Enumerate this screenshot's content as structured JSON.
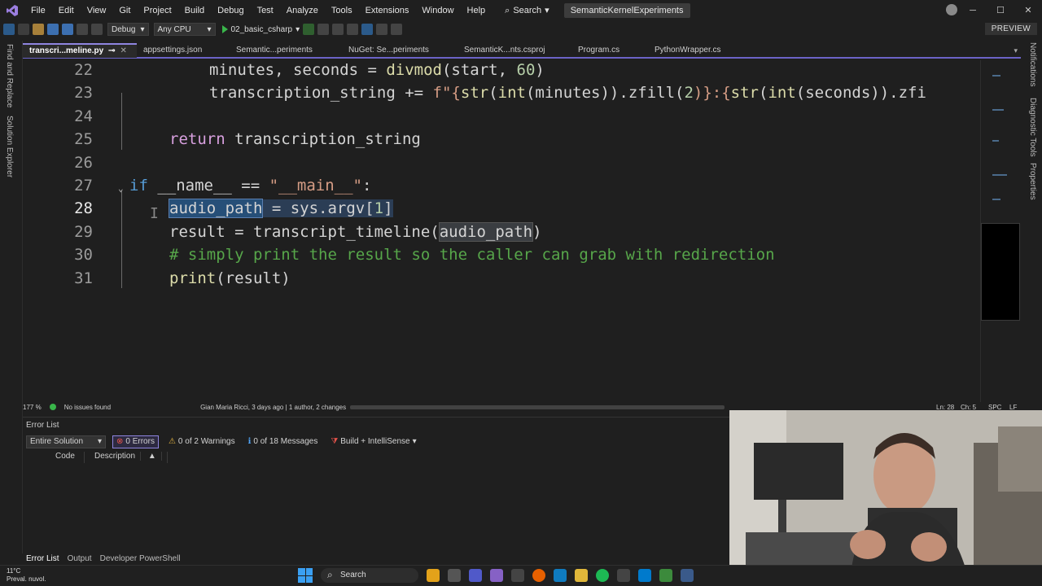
{
  "menubar": {
    "items": [
      "File",
      "Edit",
      "View",
      "Git",
      "Project",
      "Build",
      "Debug",
      "Test",
      "Analyze",
      "Tools",
      "Extensions",
      "Window",
      "Help"
    ],
    "search_label": "Search",
    "solution_name": "SemanticKernelExperiments"
  },
  "toolbar": {
    "config": "Debug",
    "platform": "Any CPU",
    "startup_project": "02_basic_csharp",
    "preview_label": "PREVIEW"
  },
  "side_tabs": {
    "left": [
      "Find and Replace",
      "Solution Explorer"
    ],
    "right": [
      "Notifications",
      "Diagnostic Tools",
      "Properties"
    ]
  },
  "doc_tabs": [
    {
      "label": "transcri...meline.py",
      "active": true
    },
    {
      "label": "appsettings.json",
      "active": false
    },
    {
      "label": "Semantic...periments",
      "active": false
    },
    {
      "label": "NuGet: Se...periments",
      "active": false
    },
    {
      "label": "SemanticK...nts.csproj",
      "active": false
    },
    {
      "label": "Program.cs",
      "active": false
    },
    {
      "label": "PythonWrapper.cs",
      "active": false
    }
  ],
  "editor": {
    "line_numbers": [
      "22",
      "23",
      "24",
      "25",
      "26",
      "27",
      "28",
      "29",
      "30",
      "31"
    ],
    "current_line": "28",
    "lines": {
      "l22": {
        "a": "minutes, seconds = ",
        "b": "divmod",
        "c": "(start, ",
        "d": "60",
        "e": ")"
      },
      "l23": {
        "a": "transcription_string += ",
        "b": "f\"{",
        "c": "str",
        "d": "(",
        "e": "int",
        "f": "(minutes)).zfill(",
        "g": "2",
        "h": ")}:{",
        "i": "str",
        "j": "(",
        "k": "int",
        "l": "(seconds)).zfi"
      },
      "l25": {
        "a": "return",
        "b": " transcription_string"
      },
      "l27": {
        "a": "if",
        "b": " __name__ == ",
        "c": "\"__main__\"",
        "d": ":"
      },
      "l28": {
        "a": "audio_path",
        "b": " = sys.argv[",
        "c": "1",
        "d": "]"
      },
      "l29": {
        "a": "result = transcript_timeline(",
        "b": "audio_path",
        "c": ")"
      },
      "l30": {
        "a": "# simply print the result so the caller can grab with redirection"
      },
      "l31": {
        "a": "print",
        "b": "(result)"
      }
    }
  },
  "status": {
    "zoom": "177 %",
    "issues": "No issues found",
    "blame": "Gian Maria Ricci, 3 days ago | 1 author, 2 changes",
    "line": "Ln: 28",
    "col": "Ch: 5",
    "spc": "SPC",
    "eol": "LF"
  },
  "error_list": {
    "title": "Error List",
    "scope": "Entire Solution",
    "errors": "0 Errors",
    "warnings": "0 of 2 Warnings",
    "messages": "0 of 18 Messages",
    "build_filter": "Build + IntelliSense",
    "col_code": "Code",
    "col_description": "Description",
    "bottom_tabs": [
      "Error List",
      "Output",
      "Developer PowerShell"
    ]
  },
  "taskbar": {
    "temp": "11°C",
    "weather": "Preval. nuvol.",
    "search": "Search"
  }
}
